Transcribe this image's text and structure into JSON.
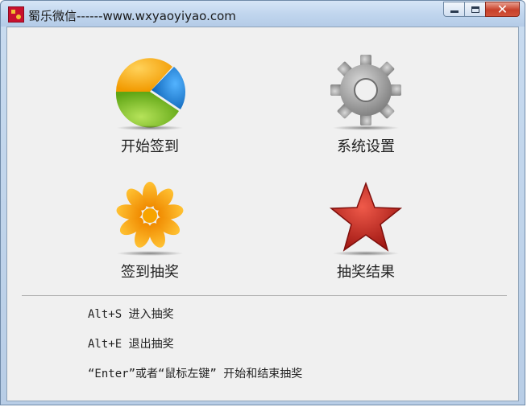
{
  "window": {
    "title": "蜀乐微信------www.wxyaoyiyao.com"
  },
  "tiles": [
    {
      "label": "开始签到",
      "icon": "pie-chart-icon"
    },
    {
      "label": "系统设置",
      "icon": "gear-icon"
    },
    {
      "label": "签到抽奖",
      "icon": "flower-icon"
    },
    {
      "label": "抽奖结果",
      "icon": "star-icon"
    }
  ],
  "hints": [
    "Alt+S 进入抽奖",
    "Alt+E 退出抽奖",
    "“Enter”或者“鼠标左键” 开始和结束抽奖"
  ],
  "colors": {
    "pie_orange": "#f5a300",
    "pie_green": "#7cc12a",
    "pie_blue": "#1d7fd6",
    "gear_gray": "#9a9a9a",
    "flower_orange": "#f59c00",
    "star_red": "#c0221c"
  }
}
